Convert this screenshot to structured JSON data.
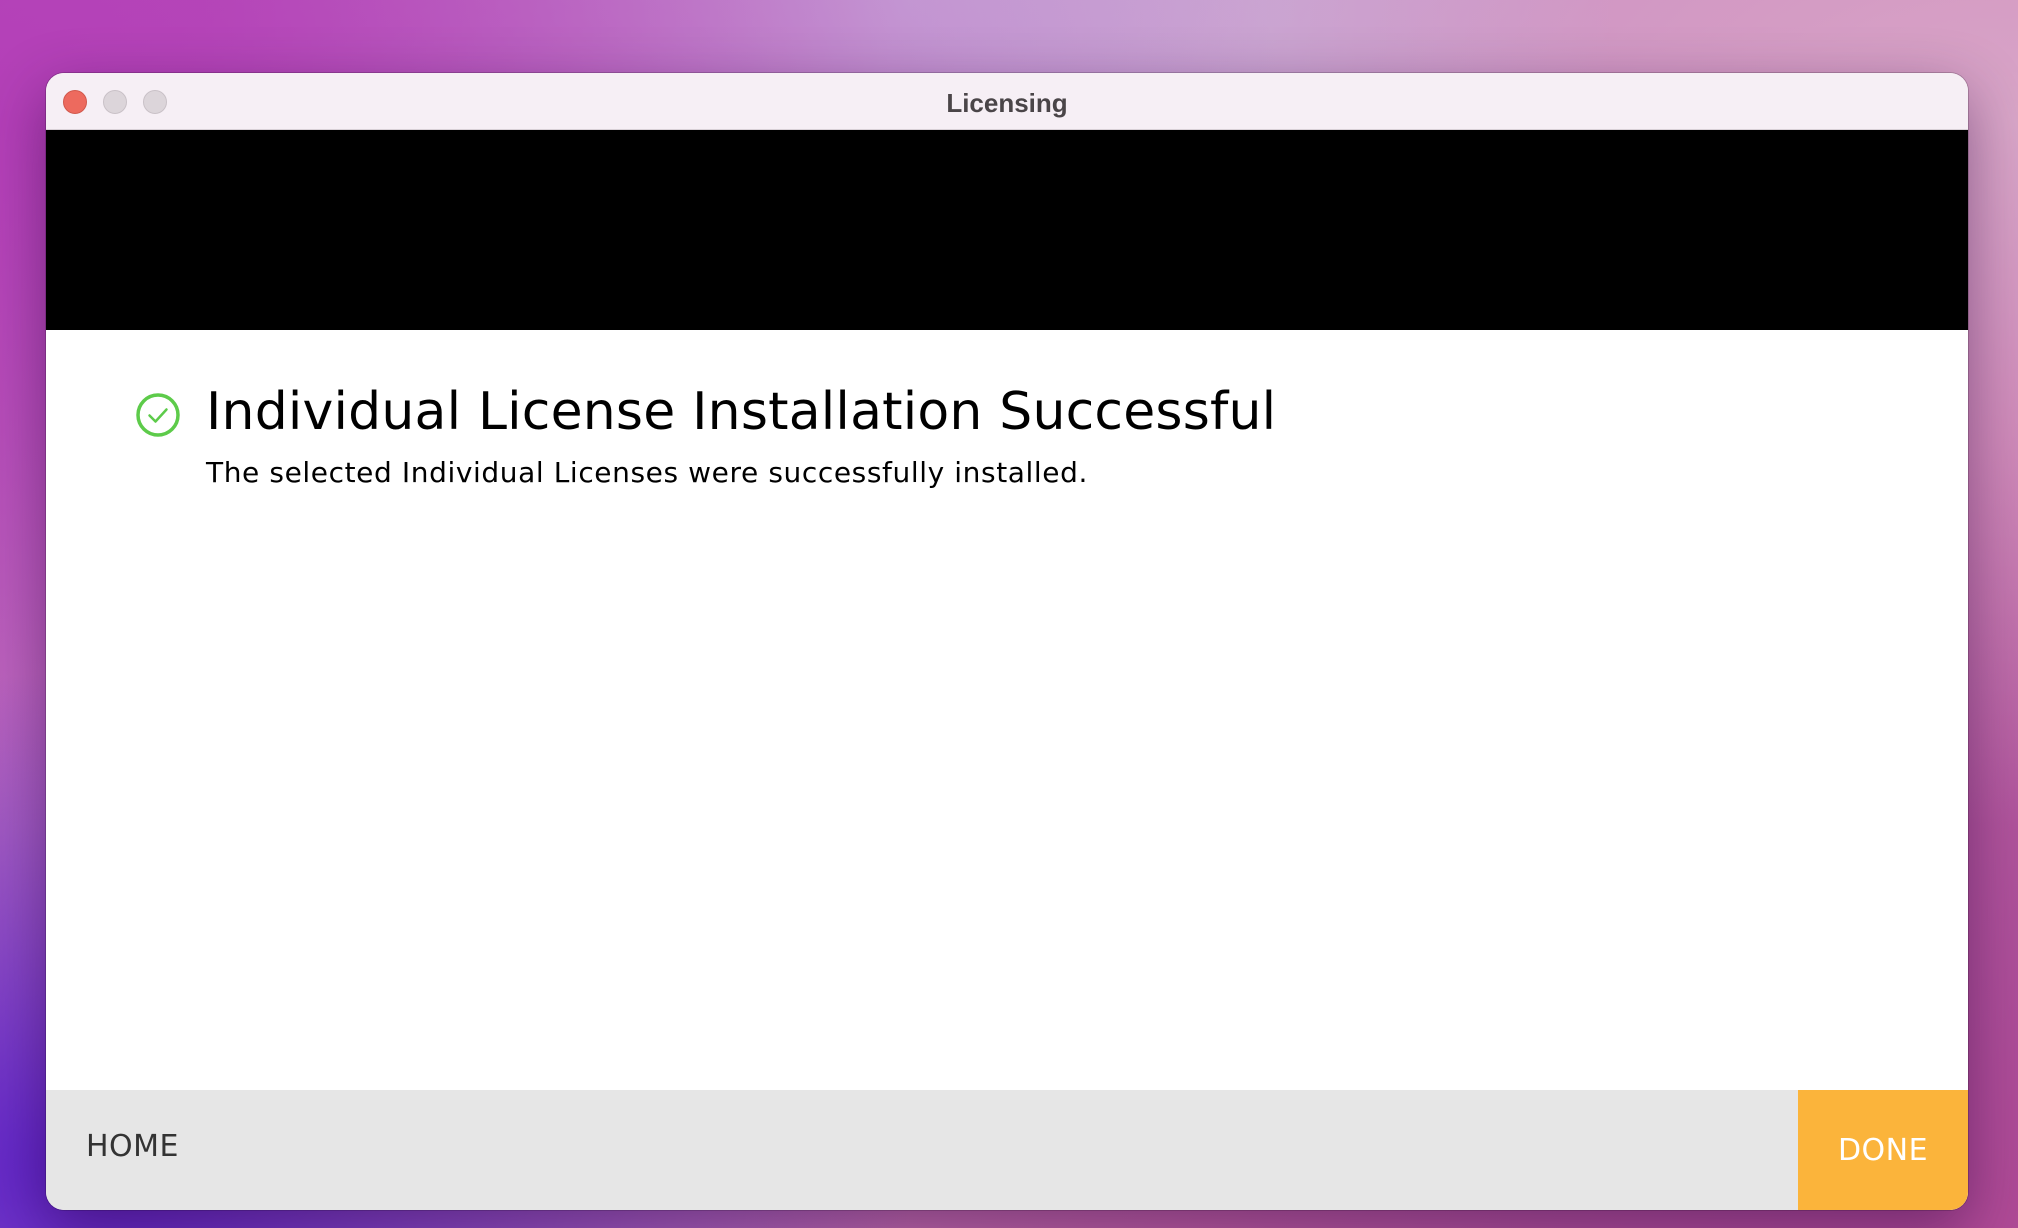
{
  "window": {
    "title": "Licensing"
  },
  "main": {
    "heading": "Individual License Installation Successful",
    "message": "The selected Individual Licenses were successfully installed.",
    "status_icon": "check-circle-icon",
    "status_color": "#5dcb4a"
  },
  "footer": {
    "home_label": "HOME",
    "done_label": "DONE",
    "done_color": "#fbb43b"
  }
}
